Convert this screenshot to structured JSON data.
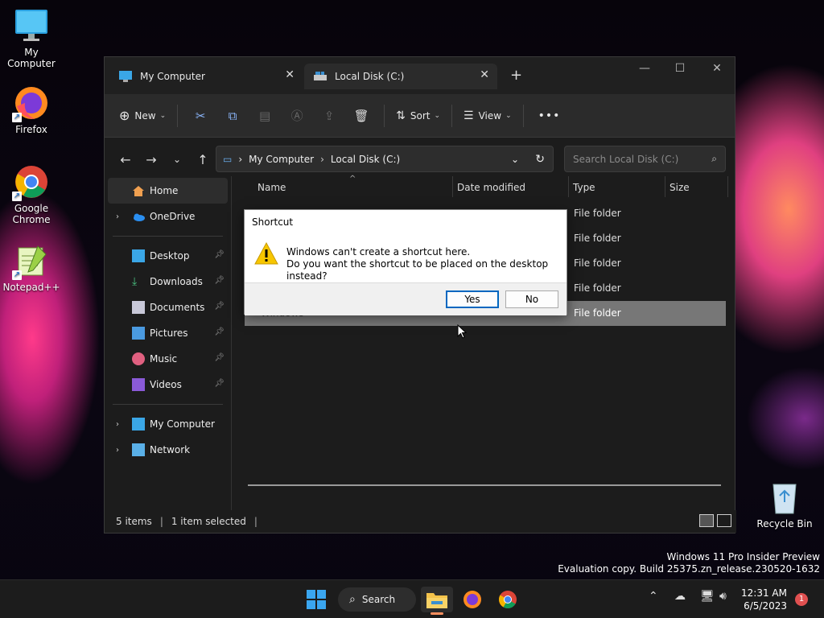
{
  "desktop": {
    "icons": [
      {
        "label": "My Computer"
      },
      {
        "label": "Firefox"
      },
      {
        "label": "Google Chrome"
      },
      {
        "label": "Notepad++"
      },
      {
        "label": "Recycle Bin"
      }
    ],
    "watermark": {
      "line1": "Windows 11 Pro Insider Preview",
      "line2": "Evaluation copy. Build 25375.zn_release.230520-1632"
    }
  },
  "explorer": {
    "tabs": [
      {
        "label": "My Computer",
        "active": false
      },
      {
        "label": "Local Disk (C:)",
        "active": true
      }
    ],
    "toolbar": {
      "new_label": "New",
      "sort_label": "Sort",
      "view_label": "View",
      "more_label": "•••"
    },
    "address": {
      "crumbs": [
        "My Computer",
        "Local Disk (C:)"
      ],
      "search_placeholder": "Search Local Disk (C:)"
    },
    "sidebar": {
      "items": [
        {
          "label": "Home",
          "icon": "home-icon"
        },
        {
          "label": "OneDrive",
          "icon": "cloud-icon"
        },
        {
          "label": "Desktop",
          "icon": "desktop-folder-icon",
          "pinned": true
        },
        {
          "label": "Downloads",
          "icon": "download-icon",
          "pinned": true
        },
        {
          "label": "Documents",
          "icon": "documents-icon",
          "pinned": true
        },
        {
          "label": "Pictures",
          "icon": "pictures-icon",
          "pinned": true
        },
        {
          "label": "Music",
          "icon": "music-icon",
          "pinned": true
        },
        {
          "label": "Videos",
          "icon": "videos-icon",
          "pinned": true
        },
        {
          "label": "My Computer",
          "icon": "computer-icon"
        },
        {
          "label": "Network",
          "icon": "network-icon"
        }
      ]
    },
    "columns": [
      "Name",
      "Date modified",
      "Type",
      "Size"
    ],
    "rows": [
      {
        "type": "File folder"
      },
      {
        "type": "File folder"
      },
      {
        "type": "File folder"
      },
      {
        "type": "File folder"
      },
      {
        "name": "Windows",
        "type": "File folder",
        "selected": true
      }
    ],
    "status": {
      "items": "5 items",
      "selected": "1 item selected"
    }
  },
  "dialog": {
    "title": "Shortcut",
    "line1": "Windows can't create a shortcut here.",
    "line2": "Do you want the shortcut to be placed on the desktop instead?",
    "yes_label": "Yes",
    "no_label": "No"
  },
  "taskbar": {
    "search_label": "Search",
    "time": "12:31 AM",
    "date": "6/5/2023",
    "notifications": "1"
  }
}
